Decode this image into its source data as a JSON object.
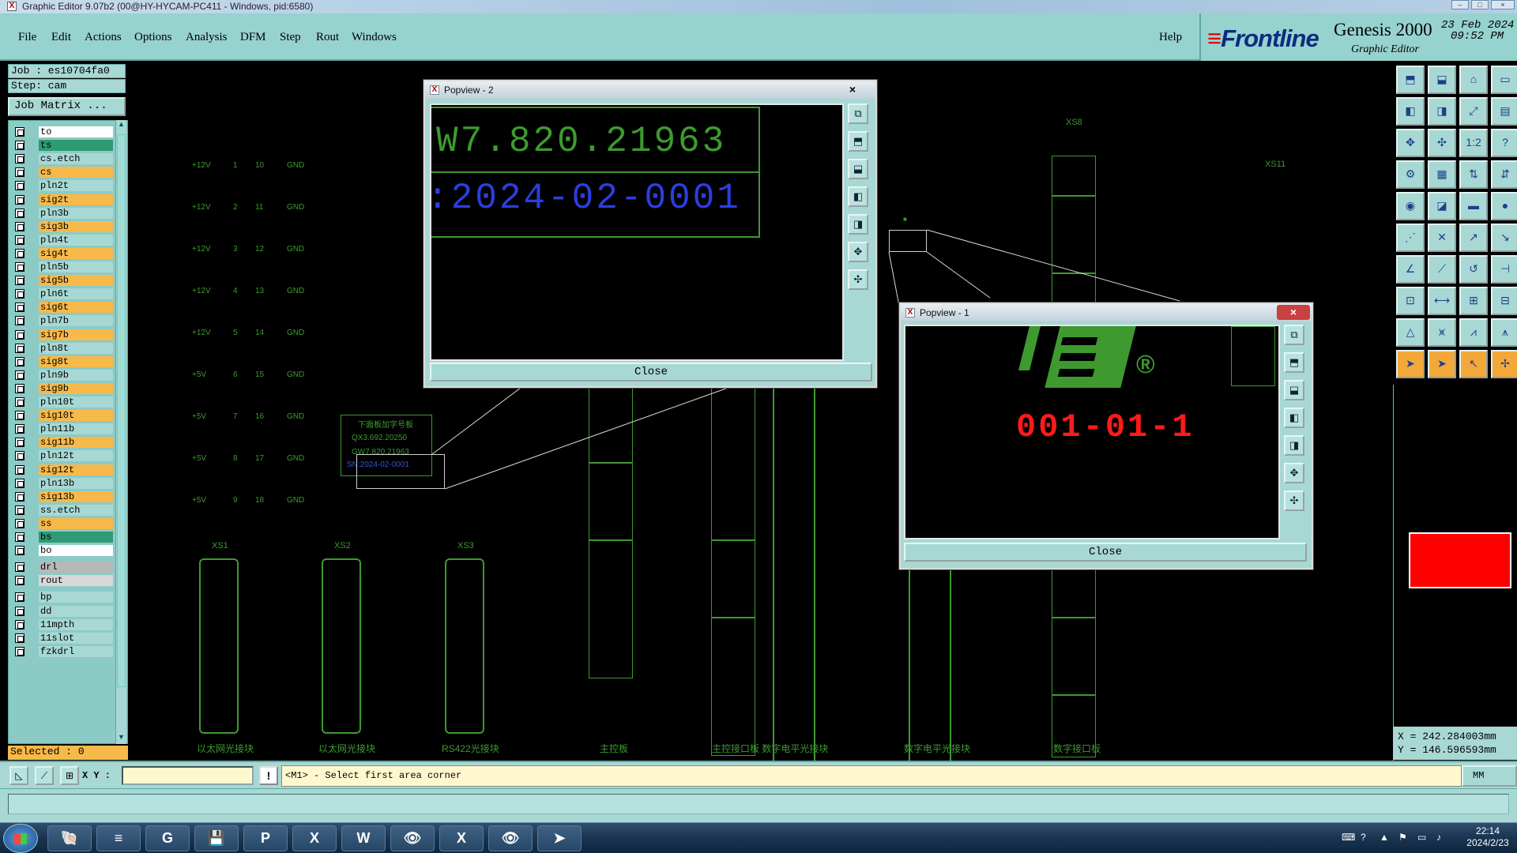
{
  "window": {
    "title": "Graphic Editor 9.07b2 (00@HY-HYCAM-PC411 - Windows, pid:6580)",
    "controls": [
      "–",
      "□",
      "×"
    ]
  },
  "menu": {
    "items": [
      "File",
      "Edit",
      "Actions",
      "Options",
      "Analysis",
      "DFM",
      "Step",
      "Rout",
      "Windows"
    ],
    "help": "Help"
  },
  "brand": {
    "logo": "Frontline",
    "product": "Genesis 2000",
    "subtitle": "Graphic Editor",
    "date": "23 Feb 2024",
    "time": "09:52 PM"
  },
  "job": {
    "job_label": "Job : es10704fa0",
    "step_label": "Step: cam",
    "matrix_button": "Job Matrix ..."
  },
  "layers": [
    {
      "name": "to",
      "color": "#ffffff"
    },
    {
      "name": "ts",
      "color": "#2e9b72"
    },
    {
      "name": "cs.etch",
      "color": "#a8d8d4"
    },
    {
      "name": "cs",
      "color": "#f7b94a"
    },
    {
      "name": "pln2t",
      "color": "#a8d8d4"
    },
    {
      "name": "sig2t",
      "color": "#f7b94a"
    },
    {
      "name": "pln3b",
      "color": "#a8d8d4"
    },
    {
      "name": "sig3b",
      "color": "#f7b94a"
    },
    {
      "name": "pln4t",
      "color": "#a8d8d4"
    },
    {
      "name": "sig4t",
      "color": "#f7b94a"
    },
    {
      "name": "pln5b",
      "color": "#a8d8d4"
    },
    {
      "name": "sig5b",
      "color": "#f7b94a"
    },
    {
      "name": "pln6t",
      "color": "#a8d8d4"
    },
    {
      "name": "sig6t",
      "color": "#f7b94a"
    },
    {
      "name": "pln7b",
      "color": "#a8d8d4"
    },
    {
      "name": "sig7b",
      "color": "#f7b94a"
    },
    {
      "name": "pln8t",
      "color": "#a8d8d4"
    },
    {
      "name": "sig8t",
      "color": "#f7b94a"
    },
    {
      "name": "pln9b",
      "color": "#a8d8d4"
    },
    {
      "name": "sig9b",
      "color": "#f7b94a"
    },
    {
      "name": "pln10t",
      "color": "#a8d8d4"
    },
    {
      "name": "sig10t",
      "color": "#f7b94a"
    },
    {
      "name": "pln11b",
      "color": "#a8d8d4"
    },
    {
      "name": "sig11b",
      "color": "#f7b94a"
    },
    {
      "name": "pln12t",
      "color": "#a8d8d4"
    },
    {
      "name": "sig12t",
      "color": "#f7b94a"
    },
    {
      "name": "pln13b",
      "color": "#a8d8d4"
    },
    {
      "name": "sig13b",
      "color": "#f7b94a"
    },
    {
      "name": "ss.etch",
      "color": "#a8d8d4"
    },
    {
      "name": "ss",
      "color": "#f7b94a"
    },
    {
      "name": "bs",
      "color": "#2e9b72"
    },
    {
      "name": "bo",
      "color": "#ffffff"
    },
    {
      "name": "drl",
      "color": "#b8b8b8"
    },
    {
      "name": "rout",
      "color": "#d8d8d8"
    },
    {
      "name": "bp",
      "color": "#a8d8d4"
    },
    {
      "name": "dd",
      "color": "#a8d8d4"
    },
    {
      "name": "11mpth",
      "color": "#a8d8d4"
    },
    {
      "name": "11slot",
      "color": "#a8d8d4"
    },
    {
      "name": "fzkdrl",
      "color": "#a8d8d4"
    }
  ],
  "selected_label": "Selected : 0",
  "canvas": {
    "connector_rows": [
      {
        "volt": "+12V",
        "a": "1",
        "b": "10",
        "net": "GND"
      },
      {
        "volt": "+12V",
        "a": "2",
        "b": "11",
        "net": "GND"
      },
      {
        "volt": "+12V",
        "a": "3",
        "b": "12",
        "net": "GND"
      },
      {
        "volt": "+12V",
        "a": "4",
        "b": "13",
        "net": "GND"
      },
      {
        "volt": "+12V",
        "a": "5",
        "b": "14",
        "net": "GND"
      },
      {
        "volt": "+5V",
        "a": "6",
        "b": "15",
        "net": "GND"
      },
      {
        "volt": "+5V",
        "a": "7",
        "b": "16",
        "net": "GND"
      },
      {
        "volt": "+5V",
        "a": "8",
        "b": "17",
        "net": "GND"
      },
      {
        "volt": "+5V",
        "a": "9",
        "b": "18",
        "net": "GND"
      }
    ],
    "ref_labels": [
      "XS1",
      "XS2",
      "XS3",
      "XS8",
      "XS11"
    ],
    "bottom_labels": [
      "以太网光接块",
      "以太网光接块",
      "RS422光接块",
      "主控板",
      "主控接口板 数字电平光接块",
      "数字电平光接块",
      "数字接口板"
    ],
    "label_block": {
      "title": "下面板加字号板",
      "line1": "QX3.692.20250",
      "line2": "GW7.820.21963",
      "line3": "SN:2024-02-0001"
    }
  },
  "popview2": {
    "title": "Popview - 2",
    "close_x": "×",
    "line1": "W7.820.21963",
    "line2": ":2024-02-0001",
    "close_label": "Close"
  },
  "popview1": {
    "title": "Popview - 1",
    "close_x": "×",
    "code": "001-01-1",
    "reg": "®",
    "close_label": "Close"
  },
  "right_toolbar": {
    "rows": [
      [
        "⬒",
        "⬓",
        "⌂",
        "▭"
      ],
      [
        "◧",
        "◨",
        "⤢",
        "▤"
      ],
      [
        "✥",
        "✣",
        "1:2",
        "?"
      ],
      [
        "⚙",
        "▦",
        "⇅",
        "⇵"
      ],
      [
        "◉",
        "◪",
        "▬",
        "●"
      ],
      [
        "⋰",
        "✕",
        "↗",
        "↘"
      ],
      [
        "∠",
        "⟋",
        "↺",
        "⊣"
      ],
      [
        "⊡",
        "⟷",
        "⊞",
        "⊟"
      ],
      [
        "△",
        "⩙",
        "⩘",
        "⩚"
      ],
      [
        "➤",
        "➤",
        "↖",
        "✢"
      ]
    ]
  },
  "coords": {
    "x": "X = 242.284003mm",
    "y": "Y = 146.596593mm"
  },
  "cmd": {
    "xy_label": "X Y :",
    "xy_value": "",
    "excl": "!",
    "prompt": "<M1> - Select first area corner",
    "unit": "MM"
  },
  "taskbar": {
    "apps": [
      "🐚",
      "≡",
      "G",
      "💾",
      "P",
      "X",
      "W",
      "👁",
      "X",
      "👁",
      "➤"
    ],
    "time": "22:14",
    "date": "2024/2/23"
  }
}
